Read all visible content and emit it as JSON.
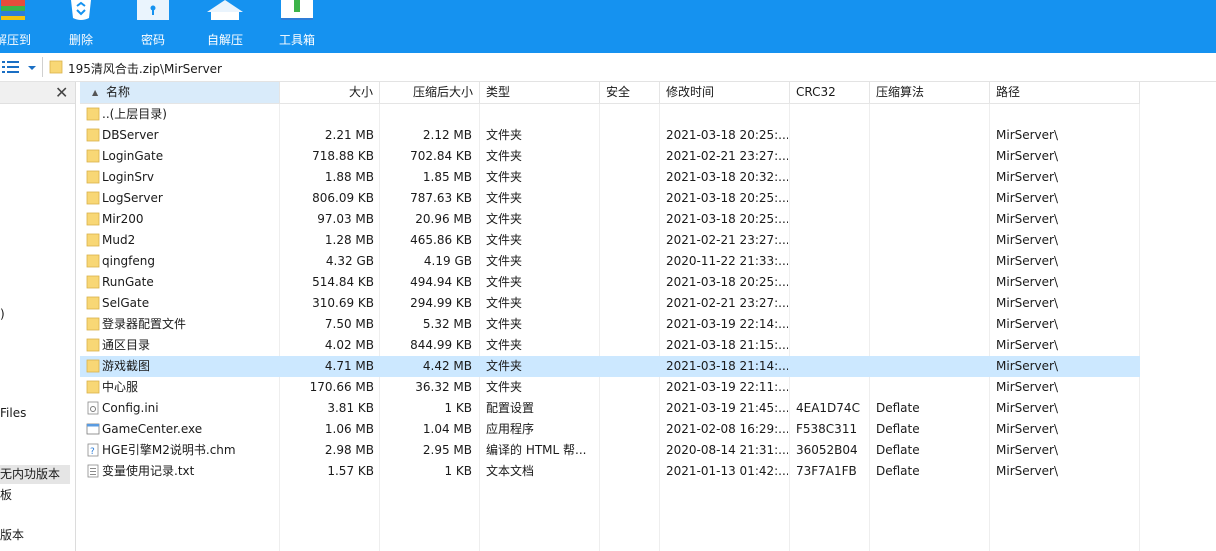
{
  "toolbar": {
    "items": [
      {
        "label": "解压到",
        "icon": "extract-icon"
      },
      {
        "label": "删除",
        "icon": "recycle-bin-icon"
      },
      {
        "label": "密码",
        "icon": "password-icon"
      },
      {
        "label": "自解压",
        "icon": "self-extract-icon"
      },
      {
        "label": "工具箱",
        "icon": "toolbox-icon"
      }
    ],
    "bg_color": "#1592f0"
  },
  "address": {
    "path": "195清风合击.zip\\MirServer"
  },
  "tree": {
    "items": [
      {
        "label": ")"
      },
      {
        "label": "Files"
      },
      {
        "label": "无内功版本"
      },
      {
        "label": "板"
      },
      {
        "label": "版本"
      }
    ]
  },
  "columns": [
    "名称",
    "大小",
    "压缩后大小",
    "类型",
    "安全",
    "修改时间",
    "CRC32",
    "压缩算法",
    "路径"
  ],
  "files": [
    {
      "name": "..(上层目录)",
      "size": "",
      "packed": "",
      "type": "",
      "modified": "",
      "crc": "",
      "method": "",
      "path": "",
      "icon": "folder"
    },
    {
      "name": "DBServer",
      "size": "2.21 MB",
      "packed": "2.12 MB",
      "type": "文件夹",
      "modified": "2021-03-18 20:25:...",
      "crc": "",
      "method": "",
      "path": "MirServer\\",
      "icon": "folder"
    },
    {
      "name": "LoginGate",
      "size": "718.88 KB",
      "packed": "702.84 KB",
      "type": "文件夹",
      "modified": "2021-02-21 23:27:...",
      "crc": "",
      "method": "",
      "path": "MirServer\\",
      "icon": "folder"
    },
    {
      "name": "LoginSrv",
      "size": "1.88 MB",
      "packed": "1.85 MB",
      "type": "文件夹",
      "modified": "2021-03-18 20:32:...",
      "crc": "",
      "method": "",
      "path": "MirServer\\",
      "icon": "folder"
    },
    {
      "name": "LogServer",
      "size": "806.09 KB",
      "packed": "787.63 KB",
      "type": "文件夹",
      "modified": "2021-03-18 20:25:...",
      "crc": "",
      "method": "",
      "path": "MirServer\\",
      "icon": "folder"
    },
    {
      "name": "Mir200",
      "size": "97.03 MB",
      "packed": "20.96 MB",
      "type": "文件夹",
      "modified": "2021-03-18 20:25:...",
      "crc": "",
      "method": "",
      "path": "MirServer\\",
      "icon": "folder"
    },
    {
      "name": "Mud2",
      "size": "1.28 MB",
      "packed": "465.86 KB",
      "type": "文件夹",
      "modified": "2021-02-21 23:27:...",
      "crc": "",
      "method": "",
      "path": "MirServer\\",
      "icon": "folder"
    },
    {
      "name": "qingfeng",
      "size": "4.32 GB",
      "packed": "4.19 GB",
      "type": "文件夹",
      "modified": "2020-11-22 21:33:...",
      "crc": "",
      "method": "",
      "path": "MirServer\\",
      "icon": "folder"
    },
    {
      "name": "RunGate",
      "size": "514.84 KB",
      "packed": "494.94 KB",
      "type": "文件夹",
      "modified": "2021-03-18 20:25:...",
      "crc": "",
      "method": "",
      "path": "MirServer\\",
      "icon": "folder"
    },
    {
      "name": "SelGate",
      "size": "310.69 KB",
      "packed": "294.99 KB",
      "type": "文件夹",
      "modified": "2021-02-21 23:27:...",
      "crc": "",
      "method": "",
      "path": "MirServer\\",
      "icon": "folder"
    },
    {
      "name": "登录器配置文件",
      "size": "7.50 MB",
      "packed": "5.32 MB",
      "type": "文件夹",
      "modified": "2021-03-19 22:14:...",
      "crc": "",
      "method": "",
      "path": "MirServer\\",
      "icon": "folder"
    },
    {
      "name": "通区目录",
      "size": "4.02 MB",
      "packed": "844.99 KB",
      "type": "文件夹",
      "modified": "2021-03-18 21:15:...",
      "crc": "",
      "method": "",
      "path": "MirServer\\",
      "icon": "folder"
    },
    {
      "name": "游戏截图",
      "size": "4.71 MB",
      "packed": "4.42 MB",
      "type": "文件夹",
      "modified": "2021-03-18 21:14:...",
      "crc": "",
      "method": "",
      "path": "MirServer\\",
      "icon": "folder",
      "selected": true
    },
    {
      "name": "中心服",
      "size": "170.66 MB",
      "packed": "36.32 MB",
      "type": "文件夹",
      "modified": "2021-03-19 22:11:...",
      "crc": "",
      "method": "",
      "path": "MirServer\\",
      "icon": "folder"
    },
    {
      "name": "Config.ini",
      "size": "3.81 KB",
      "packed": "1 KB",
      "type": "配置设置",
      "modified": "2021-03-19 21:45:...",
      "crc": "4EA1D74C",
      "method": "Deflate",
      "path": "MirServer\\",
      "icon": "ini"
    },
    {
      "name": "GameCenter.exe",
      "size": "1.06 MB",
      "packed": "1.04 MB",
      "type": "应用程序",
      "modified": "2021-02-08 16:29:...",
      "crc": "F538C311",
      "method": "Deflate",
      "path": "MirServer\\",
      "icon": "exe"
    },
    {
      "name": "HGE引擎M2说明书.chm",
      "size": "2.98 MB",
      "packed": "2.95 MB",
      "type": "编译的 HTML 帮...",
      "modified": "2020-08-14 21:31:...",
      "crc": "36052B04",
      "method": "Deflate",
      "path": "MirServer\\",
      "icon": "chm"
    },
    {
      "name": "变量使用记录.txt",
      "size": "1.57 KB",
      "packed": "1 KB",
      "type": "文本文档",
      "modified": "2021-01-13 01:42:...",
      "crc": "73F7A1FB",
      "method": "Deflate",
      "path": "MirServer\\",
      "icon": "txt"
    }
  ],
  "colors": {
    "selected_row": "#cce8ff",
    "sorted_header": "#d9ebfa",
    "folder": "#f8d775"
  }
}
